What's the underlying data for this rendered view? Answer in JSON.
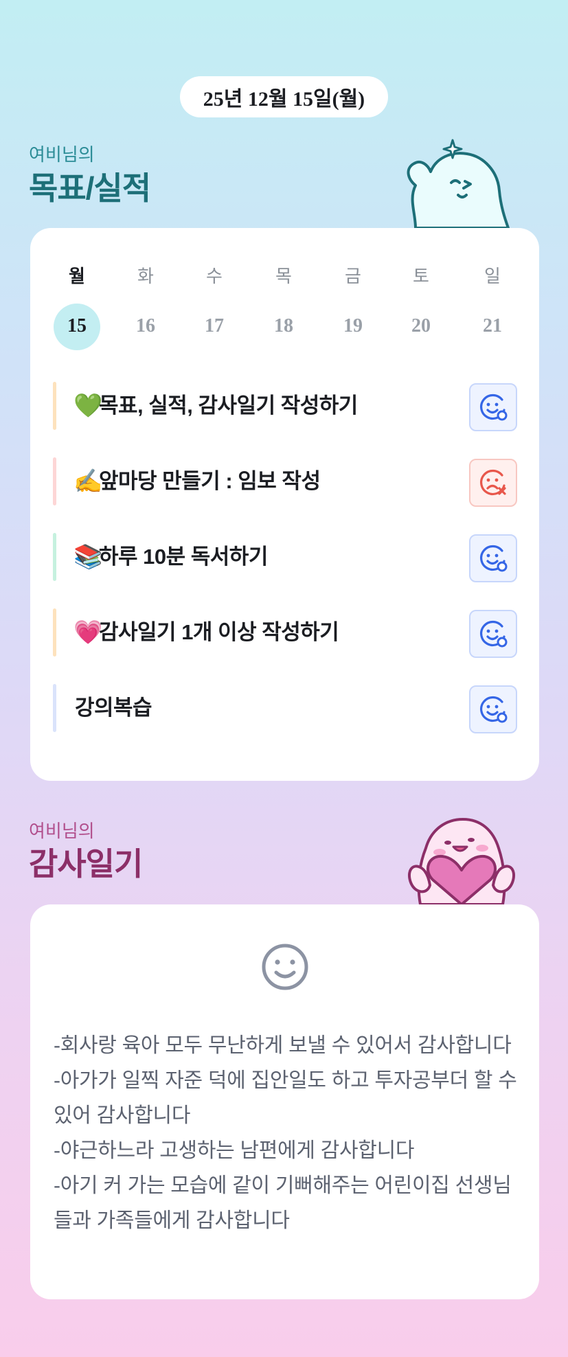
{
  "date_label": "25년 12월 15일(월)",
  "goals_section": {
    "subtitle": "여비님의",
    "title": "목표/실적"
  },
  "week": {
    "days": [
      "월",
      "화",
      "수",
      "목",
      "금",
      "토",
      "일"
    ],
    "dates": [
      "15",
      "16",
      "17",
      "18",
      "19",
      "20",
      "21"
    ],
    "selected_index": 0
  },
  "goals": [
    {
      "emoji": "💚",
      "text": "목표, 실적, 감사일기 작성하기",
      "bar_color": "#fde2bd",
      "status": "done"
    },
    {
      "emoji": "✍️",
      "text": "앞마당 만들기 : 임보 작성",
      "bar_color": "#fdd6d6",
      "status": "missed"
    },
    {
      "emoji": "📚",
      "text": "하루 10분 독서하기",
      "bar_color": "#c6f1df",
      "status": "done"
    },
    {
      "emoji": "💗",
      "text": "감사일기 1개 이상 작성하기",
      "bar_color": "#fde2bd",
      "status": "done"
    },
    {
      "emoji": "",
      "text": "강의복습",
      "bar_color": "#dae3fb",
      "status": "done"
    }
  ],
  "gratitude_section": {
    "subtitle": "여비님의",
    "title": "감사일기"
  },
  "gratitude_lines": [
    "-회사랑 육아 모두 무난하게 보낼 수 있어서 감사합니다",
    "-아가가 일찍 자준 덕에 집안일도 하고 투자공부더 할 수 있어 감사합니다",
    "-야근하느라 고생하는 남편에게 감사합니다",
    "-아기 커 가는 모습에 같이 기뻐해주는 어린이집 선생님들과 가족들에게 감사합니다"
  ],
  "colors": {
    "goals_title": "#1d6f78",
    "goals_subtitle": "#2b8c96",
    "gratitude_title": "#8c2f68",
    "gratitude_subtitle": "#b14f8c",
    "status_ok": "#3566e6",
    "status_fail": "#e8574b"
  },
  "icons": {
    "status_done": "smile-face-check-icon",
    "status_missed": "sad-face-x-icon",
    "gratitude_header": "smile-face-icon"
  }
}
